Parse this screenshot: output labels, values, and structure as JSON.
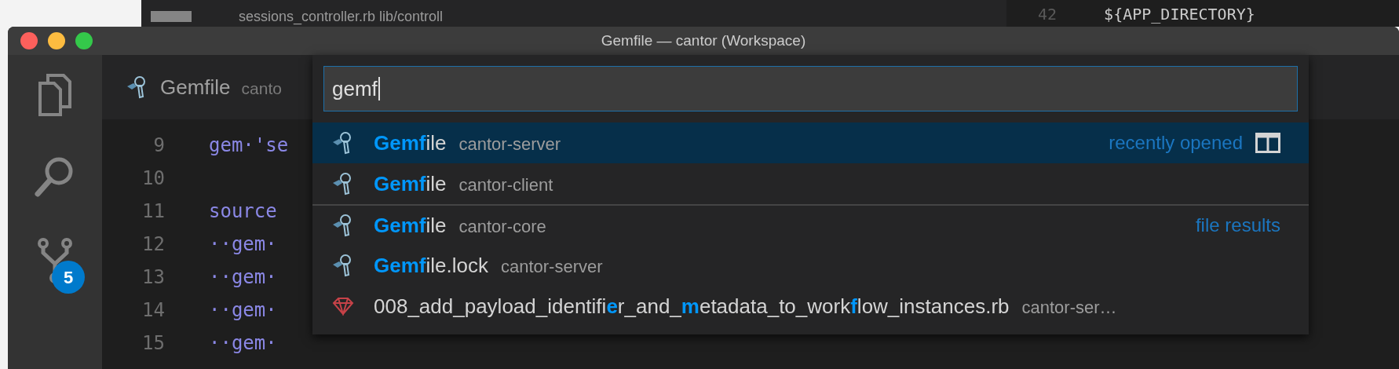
{
  "background": {
    "file_tab": "sessions_controller.rb lib/controll",
    "line_number": "42",
    "code": "${APP_DIRECTORY}"
  },
  "window": {
    "title": "Gemfile — cantor (Workspace)"
  },
  "activity_bar": {
    "source_control_badge": "5"
  },
  "editor_tab": {
    "name": "Gemfile",
    "folder": "canto"
  },
  "editor": {
    "lines": [
      {
        "number": "9",
        "code": "gem·'se"
      },
      {
        "number": "10"
      },
      {
        "number": "11",
        "code": "source"
      },
      {
        "number": "12",
        "code": "··gem·"
      },
      {
        "number": "13",
        "code": "··gem·"
      },
      {
        "number": "14",
        "code": "··gem·"
      },
      {
        "number": "15",
        "code": "··gem·"
      }
    ]
  },
  "quick_open": {
    "value": "gemf",
    "results": [
      {
        "kind": "gemfile",
        "label": "**Gemf**ile",
        "description": "cantor-server",
        "group": "recently opened",
        "selected": true,
        "separator": false
      },
      {
        "kind": "gemfile",
        "label": "**Gemf**ile",
        "description": "cantor-client",
        "selected": false,
        "separator": false
      },
      {
        "kind": "gemfile",
        "label": "**Gemf**ile",
        "description": "cantor-core",
        "group": "file results",
        "selected": false,
        "separator": true
      },
      {
        "kind": "gemfile",
        "label": "**Gemf**ile.lock",
        "description": "cantor-server",
        "selected": false,
        "separator": false
      },
      {
        "kind": "ruby",
        "label": "008_add_payload_identifi**e**r_and_**m**etadata_to_work**f**low_instances.rb",
        "description": "cantor-ser…",
        "selected": false,
        "separator": false
      }
    ]
  }
}
